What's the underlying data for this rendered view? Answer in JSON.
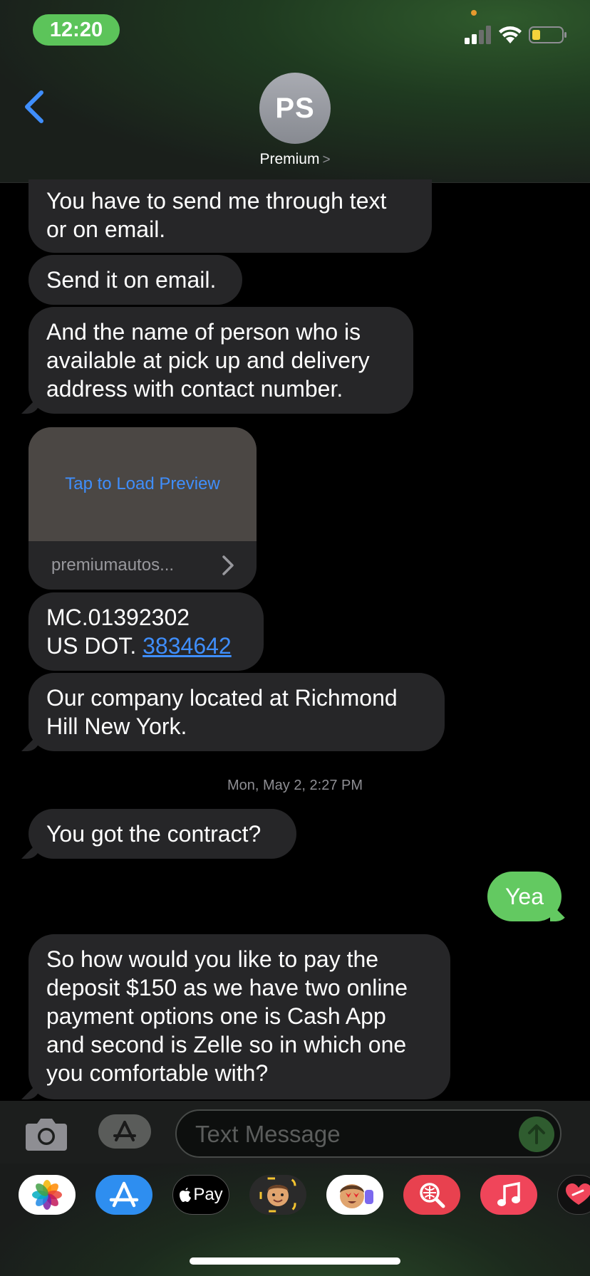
{
  "status_bar": {
    "time": "12:20"
  },
  "header": {
    "avatar_initials": "PS",
    "contact_name": "Premium",
    "chevron": ">"
  },
  "messages": [
    {
      "direction": "incoming",
      "text": "You have to send me through text or on email.",
      "lines": [
        "You have to send me through text",
        "or on email."
      ]
    },
    {
      "direction": "incoming",
      "text": "Send it on email."
    },
    {
      "direction": "incoming",
      "lines": [
        "And the name of person who is",
        "available at pick up and delivery",
        "address with contact number."
      ]
    },
    {
      "direction": "incoming",
      "type": "link_preview",
      "preview_text": "Tap to Load Preview",
      "domain": "premiumautos..."
    },
    {
      "direction": "incoming",
      "line1": "MC.01392302",
      "line2_prefix": "US DOT. ",
      "line2_link": "3834642"
    },
    {
      "direction": "incoming",
      "lines": [
        "Our company located at Richmond",
        "Hill New York."
      ]
    },
    {
      "direction": "incoming",
      "text": "You got the contract?"
    },
    {
      "direction": "outgoing",
      "text": "Yea"
    },
    {
      "direction": "incoming",
      "lines": [
        "So how would you like to pay the",
        "deposit $150 as we have two online",
        "payment options one is Cash App",
        "and second is Zelle so in which one",
        "you comfortable with?"
      ]
    }
  ],
  "timestamp": "Mon, May 2, 2:27 PM",
  "input": {
    "placeholder": "Text Message"
  },
  "app_drawer": {
    "apps": [
      "photos-icon",
      "app-store-icon",
      "apple-pay-icon",
      "memoji-icon",
      "animoji-icon",
      "image-search-icon",
      "music-icon",
      "digital-touch-icon"
    ],
    "apple_pay_label": "Pay"
  },
  "colors": {
    "incoming_bubble": "#262628",
    "outgoing_bubble": "#63c961",
    "link": "#3f8efc",
    "time_pill": "#5cc45a"
  }
}
